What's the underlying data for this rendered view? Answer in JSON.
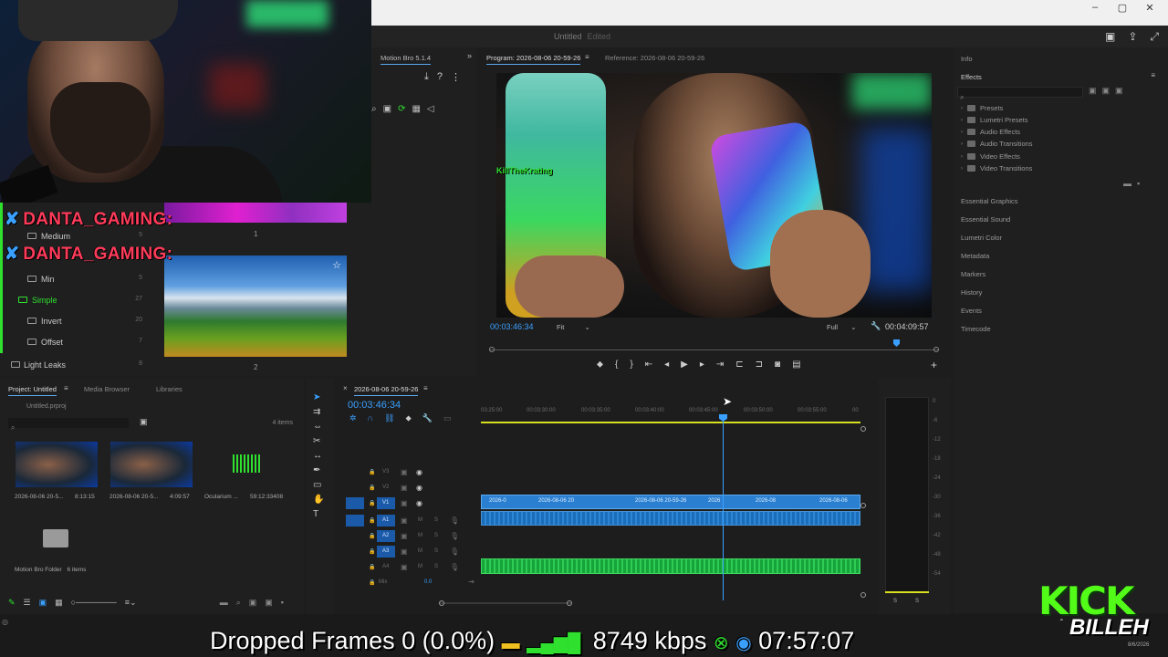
{
  "window": {
    "title": "Untitled",
    "edited": "Edited",
    "controls": [
      "–",
      "▢",
      "✕"
    ]
  },
  "chat": {
    "messages": [
      {
        "user": "DANTA_GAMING:"
      },
      {
        "user": "DANTA_GAMING:"
      }
    ]
  },
  "left_folders": [
    {
      "label": "Medium",
      "count": "5"
    },
    {
      "label": "Min",
      "count": "5"
    },
    {
      "label": "Simple",
      "count": "27"
    },
    {
      "label": "Invert",
      "count": "20"
    },
    {
      "label": "Offset",
      "count": "7"
    },
    {
      "label": "Light Leaks",
      "count": "8"
    }
  ],
  "thumbs": {
    "num1": "1",
    "num2": "2"
  },
  "motion_bro": {
    "title": "Motion Bro 5.1.4"
  },
  "program": {
    "tab": "Program: 2026-08-06 20-59-26",
    "reference": "Reference: 2026-08-06 20-59-26",
    "timecode": "00:03:46:34",
    "fit": "Fit",
    "quality": "Full",
    "duration": "00:04:09:57",
    "overlay_user": "KillTheKrating"
  },
  "right_panel": {
    "info": "Info",
    "effects": "Effects",
    "tree": [
      "Presets",
      "Lumetri Presets",
      "Audio Effects",
      "Audio Transitions",
      "Video Effects",
      "Video Transitions"
    ],
    "sections": [
      "Essential Graphics",
      "Essential Sound",
      "Lumetri Color",
      "Metadata",
      "Markers",
      "History",
      "Events",
      "Timecode"
    ]
  },
  "project": {
    "tabs": [
      "Project: Untitled",
      "Media Browser",
      "Libraries"
    ],
    "file": "Untitled.prproj",
    "items_count": "4 items",
    "items": [
      {
        "name": "2026-08-06 20-5...",
        "dur": "8:13:15"
      },
      {
        "name": "2026-08-06 20-5...",
        "dur": "4:09:57"
      },
      {
        "name": "Ocularium ...",
        "dur": "59:12:33408"
      }
    ],
    "folder": "Motion Bro Folder",
    "folder_count": "6 items"
  },
  "timeline": {
    "tab": "2026-08-06 20-59-26",
    "timecode": "00:03:46:34",
    "ruler": [
      "03:25:00",
      "00:03:30:00",
      "00:03:35:00",
      "00:03:40:00",
      "00:03:45:00",
      "00:03:50:00",
      "00:03:55:00",
      "00"
    ],
    "tracks": [
      "V3",
      "V2",
      "V1",
      "A1",
      "A2",
      "A3",
      "A4",
      "Mix"
    ],
    "mix_value": "0.0",
    "clips": [
      "2026-0",
      "2026-08-06 20",
      "2026-08-06 20-59-26",
      "2026",
      "2026-08",
      "2026-08-06"
    ]
  },
  "meters": {
    "scale": [
      "0",
      "-6",
      "-12",
      "-18",
      "-24",
      "-30",
      "-36",
      "-42",
      "-48",
      "-54"
    ],
    "solo": [
      "S",
      "S"
    ]
  },
  "obs": {
    "dropped": "Dropped Frames 0 (0.0%)",
    "bitrate": "8749 kbps",
    "clock": "07:57:07"
  },
  "kick": {
    "brand": "KICK",
    "name": "BILLEH",
    "date": "8/6/2026"
  },
  "colors": {
    "accent": "#2b7fd0",
    "green": "#2fe02f",
    "chat_red": "#ff3b5a",
    "kick": "#53fc18"
  }
}
